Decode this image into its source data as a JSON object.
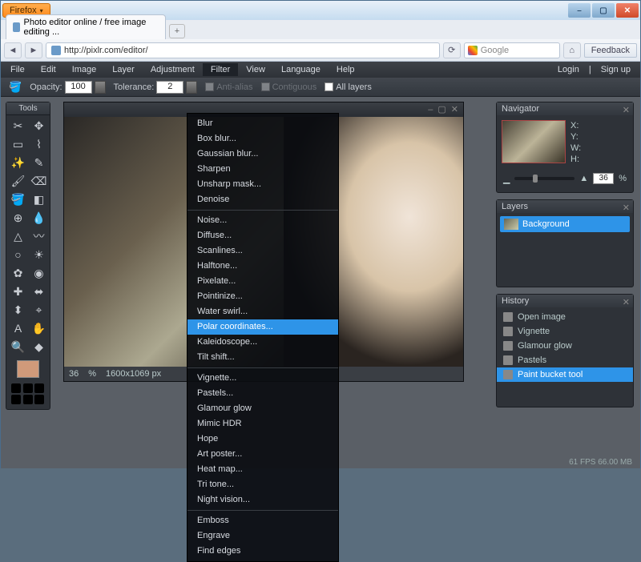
{
  "browser": {
    "name": "Firefox",
    "tab_title": "Photo editor online / free image editing ...",
    "url": "http://pixlr.com/editor/",
    "search_placeholder": "Google",
    "feedback": "Feedback",
    "new_tab": "+"
  },
  "menu": {
    "items": [
      "File",
      "Edit",
      "Image",
      "Layer",
      "Adjustment",
      "Filter",
      "View",
      "Language",
      "Help"
    ],
    "active_index": 5,
    "right": {
      "login": "Login",
      "signup": "Sign up"
    }
  },
  "options": {
    "opacity_label": "Opacity:",
    "opacity": "100",
    "tolerance_label": "Tolerance:",
    "tolerance": "2",
    "antialias": "Anti-alias",
    "contiguous": "Contiguous",
    "all_layers": "All layers"
  },
  "tools_title": "Tools",
  "tools": [
    "crop",
    "move",
    "marquee",
    "lasso",
    "wand",
    "pencil",
    "brush",
    "eraser",
    "bucket",
    "gradient",
    "clone",
    "blur",
    "sharpen",
    "smudge",
    "sponge",
    "dodge",
    "burn",
    "redeye",
    "spot",
    "bloat",
    "pinch",
    "picker",
    "type",
    "hand",
    "zoom",
    "shape"
  ],
  "swatch_color": "#d09a7a",
  "canvas": {
    "zoom": "36",
    "zoom_unit": "%",
    "dims": "1600x1069 px"
  },
  "navigator": {
    "title": "Navigator",
    "x": "X:",
    "y": "Y:",
    "w": "W:",
    "h": "H:",
    "zoom": "36",
    "unit": "%"
  },
  "layers": {
    "title": "Layers",
    "bg": "Background"
  },
  "history": {
    "title": "History",
    "items": [
      "Open image",
      "Vignette",
      "Glamour glow",
      "Pastels",
      "Paint bucket tool"
    ],
    "selected_index": 4
  },
  "filter_menu": {
    "groups": [
      [
        "Blur",
        "Box blur...",
        "Gaussian blur...",
        "Sharpen",
        "Unsharp mask...",
        "Denoise"
      ],
      [
        "Noise...",
        "Diffuse...",
        "Scanlines...",
        "Halftone...",
        "Pixelate...",
        "Pointinize...",
        "Water swirl...",
        "Polar coordinates...",
        "Kaleidoscope...",
        "Tilt shift..."
      ],
      [
        "Vignette...",
        "Pastels...",
        "Glamour glow",
        "Mimic HDR",
        "Hope",
        "Art poster...",
        "Heat map...",
        "Tri tone...",
        "Night vision..."
      ],
      [
        "Emboss",
        "Engrave",
        "Find edges"
      ]
    ],
    "selected": "Polar coordinates..."
  },
  "status": "61 FPS 66.00 MB"
}
